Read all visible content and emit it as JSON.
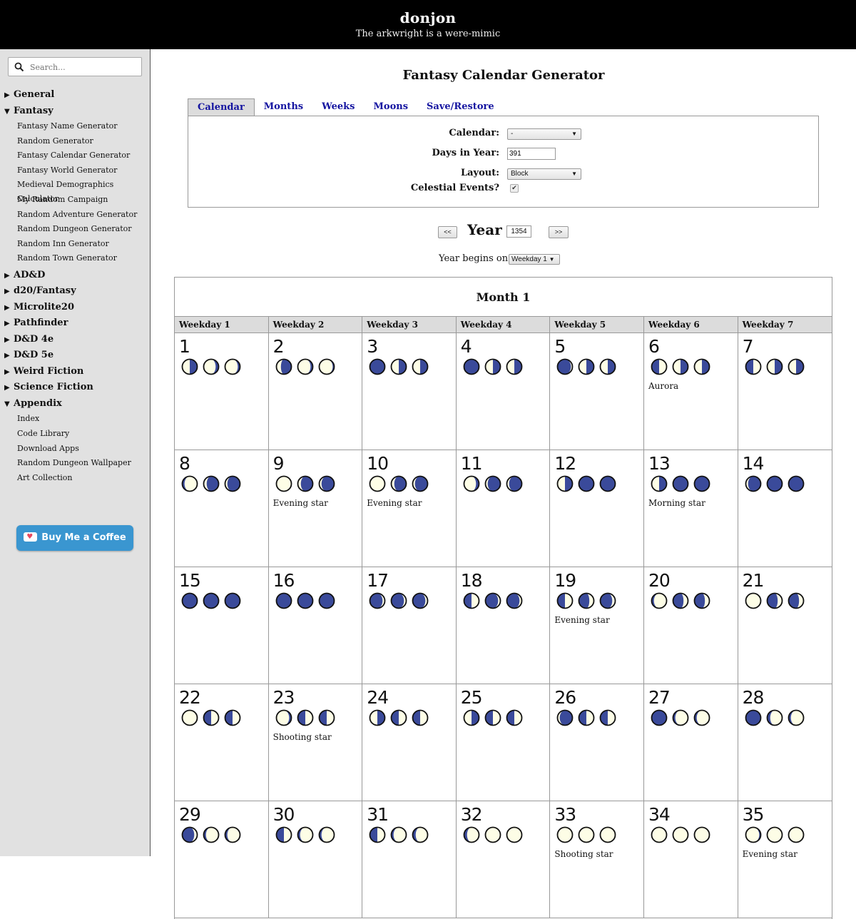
{
  "header": {
    "site_title": "donjon",
    "tagline": "The arkwright is a were-mimic"
  },
  "sidebar": {
    "search_placeholder": "Search...",
    "categories": [
      {
        "label": "General",
        "expanded": false,
        "items": []
      },
      {
        "label": "Fantasy",
        "expanded": true,
        "items": [
          "Fantasy Name Generator",
          "Random Generator",
          "Fantasy Calendar Generator",
          "Fantasy World Generator",
          "Medieval Demographics Calculator",
          "My Random Campaign",
          "Random Adventure Generator",
          "Random Dungeon Generator",
          "Random Inn Generator",
          "Random Town Generator"
        ]
      },
      {
        "label": "AD&D",
        "expanded": false,
        "items": []
      },
      {
        "label": "d20/Fantasy",
        "expanded": false,
        "items": []
      },
      {
        "label": "Microlite20",
        "expanded": false,
        "items": []
      },
      {
        "label": "Pathfinder",
        "expanded": false,
        "items": []
      },
      {
        "label": "D&D 4e",
        "expanded": false,
        "items": []
      },
      {
        "label": "D&D 5e",
        "expanded": false,
        "items": []
      },
      {
        "label": "Weird Fiction",
        "expanded": false,
        "items": []
      },
      {
        "label": "Science Fiction",
        "expanded": false,
        "items": []
      },
      {
        "label": "Appendix",
        "expanded": true,
        "items": [
          "Index",
          "Code Library",
          "Download Apps",
          "Random Dungeon Wallpaper",
          "Art Collection"
        ]
      }
    ],
    "coffee_label": "Buy Me a Coffee"
  },
  "main": {
    "title": "Fantasy Calendar Generator",
    "tabs": [
      {
        "label": "Calendar",
        "active": true
      },
      {
        "label": "Months",
        "active": false
      },
      {
        "label": "Weeks",
        "active": false
      },
      {
        "label": "Moons",
        "active": false
      },
      {
        "label": "Save/Restore",
        "active": false
      }
    ],
    "form": {
      "calendar_label": "Calendar:",
      "calendar_value": "-",
      "days_label": "Days in Year:",
      "days_value": "391",
      "layout_label": "Layout:",
      "layout_value": "Block",
      "celestial_label": "Celestial Events?",
      "celestial_checked": true
    },
    "year": {
      "prev_label": "<<",
      "label": "Year",
      "value": "1354",
      "next_label": ">>"
    },
    "begins": {
      "label": "Year begins on",
      "value": "Weekday 1"
    },
    "month": {
      "title": "Month 1",
      "weekdays": [
        "Weekday 1",
        "Weekday 2",
        "Weekday 3",
        "Weekday 4",
        "Weekday 5",
        "Weekday 6",
        "Weekday 7"
      ],
      "days": [
        {
          "n": "1",
          "moons": [
            [
              0.5,
              "L"
            ],
            [
              0.8,
              "L"
            ],
            [
              0.85,
              "L"
            ]
          ],
          "event": ""
        },
        {
          "n": "2",
          "moons": [
            [
              0.3,
              "L"
            ],
            [
              0.85,
              "L"
            ],
            [
              0.9,
              "L"
            ]
          ],
          "event": ""
        },
        {
          "n": "3",
          "moons": [
            [
              0,
              "L"
            ],
            [
              0.5,
              "L"
            ],
            [
              0.5,
              "L"
            ]
          ],
          "event": ""
        },
        {
          "n": "4",
          "moons": [
            [
              0,
              "L"
            ],
            [
              0.5,
              "L"
            ],
            [
              0.5,
              "L"
            ]
          ],
          "event": ""
        },
        {
          "n": "5",
          "moons": [
            [
              0.1,
              "R"
            ],
            [
              0.5,
              "L"
            ],
            [
              0.5,
              "L"
            ]
          ],
          "event": ""
        },
        {
          "n": "6",
          "moons": [
            [
              0.5,
              "R"
            ],
            [
              0.5,
              "L"
            ],
            [
              0.5,
              "L"
            ]
          ],
          "event": "Aurora"
        },
        {
          "n": "7",
          "moons": [
            [
              0.5,
              "R"
            ],
            [
              0.5,
              "L"
            ],
            [
              0.5,
              "L"
            ]
          ],
          "event": ""
        },
        {
          "n": "8",
          "moons": [
            [
              0.85,
              "R"
            ],
            [
              0.2,
              "L"
            ],
            [
              0.15,
              "L"
            ]
          ],
          "event": ""
        },
        {
          "n": "9",
          "moons": [
            [
              1,
              "R"
            ],
            [
              0.2,
              "L"
            ],
            [
              0.15,
              "L"
            ]
          ],
          "event": "Evening star"
        },
        {
          "n": "10",
          "moons": [
            [
              1,
              "R"
            ],
            [
              0.2,
              "L"
            ],
            [
              0.15,
              "L"
            ]
          ],
          "event": "Evening star"
        },
        {
          "n": "11",
          "moons": [
            [
              0.8,
              "L"
            ],
            [
              0.15,
              "L"
            ],
            [
              0.15,
              "L"
            ]
          ],
          "event": ""
        },
        {
          "n": "12",
          "moons": [
            [
              0.5,
              "L"
            ],
            [
              0,
              "L"
            ],
            [
              0,
              "L"
            ]
          ],
          "event": ""
        },
        {
          "n": "13",
          "moons": [
            [
              0.5,
              "L"
            ],
            [
              0,
              "L"
            ],
            [
              0,
              "L"
            ]
          ],
          "event": "Morning star"
        },
        {
          "n": "14",
          "moons": [
            [
              0.15,
              "L"
            ],
            [
              0,
              "L"
            ],
            [
              0,
              "L"
            ]
          ],
          "event": ""
        },
        {
          "n": "15",
          "moons": [
            [
              0,
              "L"
            ],
            [
              0,
              "L"
            ],
            [
              0,
              "L"
            ]
          ],
          "event": ""
        },
        {
          "n": "16",
          "moons": [
            [
              0,
              "L"
            ],
            [
              0,
              "L"
            ],
            [
              0,
              "L"
            ]
          ],
          "event": ""
        },
        {
          "n": "17",
          "moons": [
            [
              0.15,
              "R"
            ],
            [
              0.15,
              "R"
            ],
            [
              0.15,
              "R"
            ]
          ],
          "event": ""
        },
        {
          "n": "18",
          "moons": [
            [
              0.5,
              "R"
            ],
            [
              0.15,
              "R"
            ],
            [
              0.15,
              "R"
            ]
          ],
          "event": ""
        },
        {
          "n": "19",
          "moons": [
            [
              0.5,
              "R"
            ],
            [
              0.3,
              "R"
            ],
            [
              0.2,
              "R"
            ]
          ],
          "event": "Evening star"
        },
        {
          "n": "20",
          "moons": [
            [
              0.85,
              "R"
            ],
            [
              0.3,
              "R"
            ],
            [
              0.3,
              "R"
            ]
          ],
          "event": ""
        },
        {
          "n": "21",
          "moons": [
            [
              1,
              "R"
            ],
            [
              0.3,
              "R"
            ],
            [
              0.3,
              "R"
            ]
          ],
          "event": ""
        },
        {
          "n": "22",
          "moons": [
            [
              1,
              "R"
            ],
            [
              0.5,
              "R"
            ],
            [
              0.5,
              "R"
            ]
          ],
          "event": ""
        },
        {
          "n": "23",
          "moons": [
            [
              0.85,
              "L"
            ],
            [
              0.5,
              "R"
            ],
            [
              0.5,
              "R"
            ]
          ],
          "event": "Shooting star"
        },
        {
          "n": "24",
          "moons": [
            [
              0.5,
              "L"
            ],
            [
              0.5,
              "R"
            ],
            [
              0.5,
              "R"
            ]
          ],
          "event": ""
        },
        {
          "n": "25",
          "moons": [
            [
              0.5,
              "L"
            ],
            [
              0.5,
              "R"
            ],
            [
              0.5,
              "R"
            ]
          ],
          "event": ""
        },
        {
          "n": "26",
          "moons": [
            [
              0.15,
              "L"
            ],
            [
              0.5,
              "R"
            ],
            [
              0.5,
              "R"
            ]
          ],
          "event": ""
        },
        {
          "n": "27",
          "moons": [
            [
              0,
              "L"
            ],
            [
              0.85,
              "R"
            ],
            [
              0.85,
              "R"
            ]
          ],
          "event": ""
        },
        {
          "n": "28",
          "moons": [
            [
              0,
              "L"
            ],
            [
              0.8,
              "R"
            ],
            [
              0.85,
              "R"
            ]
          ],
          "event": ""
        },
        {
          "n": "29",
          "moons": [
            [
              0.2,
              "R"
            ],
            [
              0.85,
              "R"
            ],
            [
              0.85,
              "R"
            ]
          ],
          "event": ""
        },
        {
          "n": "30",
          "moons": [
            [
              0.5,
              "R"
            ],
            [
              0.85,
              "R"
            ],
            [
              0.85,
              "R"
            ]
          ],
          "event": ""
        },
        {
          "n": "31",
          "moons": [
            [
              0.5,
              "R"
            ],
            [
              0.85,
              "R"
            ],
            [
              0.8,
              "R"
            ]
          ],
          "event": ""
        },
        {
          "n": "32",
          "moons": [
            [
              0.8,
              "R"
            ],
            [
              1,
              "R"
            ],
            [
              1,
              "R"
            ]
          ],
          "event": ""
        },
        {
          "n": "33",
          "moons": [
            [
              1,
              "R"
            ],
            [
              1,
              "R"
            ],
            [
              1,
              "R"
            ]
          ],
          "event": "Shooting star"
        },
        {
          "n": "34",
          "moons": [
            [
              1,
              "R"
            ],
            [
              1,
              "R"
            ],
            [
              1,
              "R"
            ]
          ],
          "event": ""
        },
        {
          "n": "35",
          "moons": [
            [
              0.9,
              "L"
            ],
            [
              1,
              "R"
            ],
            [
              1,
              "R"
            ]
          ],
          "event": "Evening star"
        }
      ]
    }
  },
  "colors": {
    "moon_dark": "#3a4a9a",
    "moon_light": "#fdfde6",
    "link": "#1414a0",
    "header_bg": "#000000",
    "sidebar_bg": "#e1e1e1"
  }
}
